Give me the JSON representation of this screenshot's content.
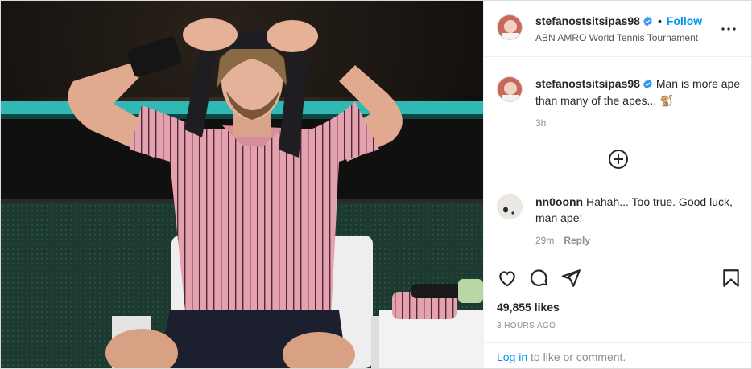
{
  "post": {
    "image_alt": "Tennis player in pink shirt tying a black headband while seated on a courtside chair",
    "author": {
      "username": "stefanostsitsipas98",
      "verified": true,
      "follow_label": "Follow",
      "location": "ABN AMRO World Tennis Tournament"
    },
    "caption": {
      "username": "stefanostsitsipas98",
      "text": "Man is more ape than many of the apes... 🐒",
      "time": "3h"
    },
    "comments": [
      {
        "username": "nn0oonn",
        "text": "Hahah... Too true. Good luck, man ape!",
        "time": "29m",
        "reply_label": "Reply"
      }
    ],
    "likes": "49,855 likes",
    "posted": "3 HOURS AGO",
    "login_prompt": {
      "link": "Log in",
      "rest": " to like or comment."
    }
  },
  "icons": {
    "more": "more-options-icon",
    "load_more": "plus-circle-icon",
    "like": "heart-icon",
    "comment": "comment-bubble-icon",
    "share": "paper-plane-icon",
    "save": "bookmark-icon",
    "verified": "verified-badge-icon"
  },
  "colors": {
    "accent": "#0095f6",
    "text": "#262626",
    "muted": "#8e8e8e",
    "border": "#efefef"
  }
}
